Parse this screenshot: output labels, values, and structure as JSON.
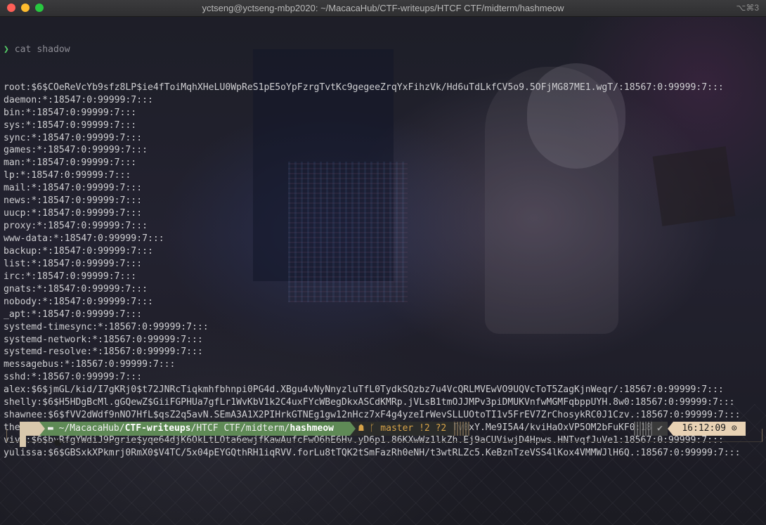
{
  "window": {
    "title": "yctseng@yctseng-mbp2020: ~/MacacaHub/CTF-writeups/HTCF CTF/midterm/hashmeow",
    "shortcut": "⌥⌘3"
  },
  "terminal": {
    "prompt_symbol": "❯",
    "command": "cat shadow",
    "lines": [
      "root:$6$COeReVcYb9sfz8LP$ie4fToiMqhXHeLU0WpReS1pE5oYpFzrgTvtKc9gegeeZrqYxFihzVk/Hd6uTdLkfCV5o9.5OFjMG87ME1.wgT/:18567:0:99999:7:::",
      "daemon:*:18547:0:99999:7:::",
      "bin:*:18547:0:99999:7:::",
      "sys:*:18547:0:99999:7:::",
      "sync:*:18547:0:99999:7:::",
      "games:*:18547:0:99999:7:::",
      "man:*:18547:0:99999:7:::",
      "lp:*:18547:0:99999:7:::",
      "mail:*:18547:0:99999:7:::",
      "news:*:18547:0:99999:7:::",
      "uucp:*:18547:0:99999:7:::",
      "proxy:*:18547:0:99999:7:::",
      "www-data:*:18547:0:99999:7:::",
      "backup:*:18547:0:99999:7:::",
      "list:*:18547:0:99999:7:::",
      "irc:*:18547:0:99999:7:::",
      "gnats:*:18547:0:99999:7:::",
      "nobody:*:18547:0:99999:7:::",
      "_apt:*:18547:0:99999:7:::",
      "systemd-timesync:*:18567:0:99999:7:::",
      "systemd-network:*:18567:0:99999:7:::",
      "systemd-resolve:*:18567:0:99999:7:::",
      "messagebus:*:18567:0:99999:7:::",
      "sshd:*:18567:0:99999:7:::",
      "alex:$6$jmGL/kid/I7gKRj0$t72JNRcTiqkmhfbhnpi0PG4d.XBgu4vNyNnyzluTfL0TydkSQzbz7u4VcQRLMVEwVO9UQVcToT5ZagKjnWeqr/:18567:0:99999:7:::",
      "shelly:$6$H5HDgBcMl.gGQewZ$GiiFGPHUa7gfLr1WvKbV1k2C4uxFYcWBegDkxASCdKMRp.jVLsB1tmOJJMPv3piDMUKVnfwMGMFqbppUYH.8w0:18567:0:99999:7:::",
      "shawnee:$6$fVV2dWdf9nNO7HfL$qsZ2q5avN.SEmA3A1X2PIHrkGTNEg1gw12nHcz7xF4g4yzeIrWevSLLUOtoTI1v5FrEV7ZrChosykRC0J1Czv.:18567:0:99999:7:::",
      "therine:$6$MynAxSZN1ai0i4bd$.jkurP8Ni4iw.u.5WhOu0.Ye5KoaBb/KF9qsZ2woqQRKQXGPz1d/UTv0xY.Me9I5A4/kviHaOxVP5OM2bFuKF0:18567:0:99999:7:::",
      "vivi:$6$bvRfgYWdiJ9Pgrie$yqe64djK6OkLtLOta6ewjfKawAufcFwO6hE6Hv.yD6p1.86KXwWz1lkZh.Ej9aCUViwjD4Hpws.HNTvqfJuVe1:18567:0:99999:7:::",
      "yulissa:$6$GBSxkXPkmrj0RmX0$V4TC/5x04pEYGQthRH1iqRVV.forLu8tTQK2tSmFazRh0eNH/t3wtRLZc5.KeBznTzeVSS4lKox4VMMWJlH6Q.:18567:0:99999:7:::"
    ]
  },
  "prompt": {
    "os_icon": "apple-icon",
    "path_prefix": "~/MacacaHub/",
    "path_bold_1": "CTF-writeups",
    "path_middle": "/HTCF CTF/midterm/",
    "path_bold_2": "hashmeow",
    "git_icon": "github-icon",
    "branch_icon": "branch-icon",
    "branch": "master",
    "git_status": "!2 ?2",
    "status_icon": "✔",
    "time": "16:12:09",
    "clock_icon": "clock-icon"
  },
  "colors": {
    "prompt_arrow": "#58d66a",
    "path_segment": "#5f8a56",
    "git_segment_text": "#d6a248",
    "time_segment": "#e8d2b4"
  }
}
